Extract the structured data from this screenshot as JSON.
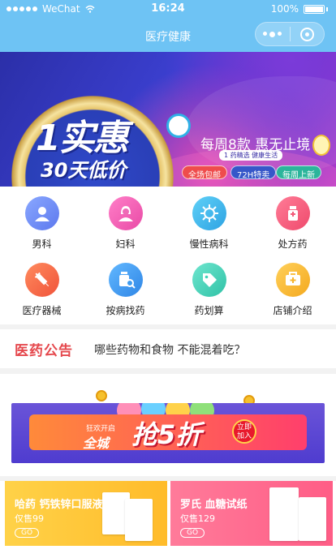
{
  "status_bar": {
    "signal": "●●●●●",
    "carrier": "WeChat",
    "time": "16:24",
    "battery": "100%"
  },
  "title_bar": {
    "title": "医疗健康"
  },
  "banner": {
    "headline": "1实惠",
    "sub_headline": "30天低价",
    "promo_text": "每周8款 惠无止境",
    "promo_sub": "1 药精选 健康生活",
    "tags": [
      "全场包邮",
      "72H特卖",
      "每周上新"
    ]
  },
  "categories": [
    {
      "label": "男科",
      "icon": "male-user-icon",
      "color": "#6d8df6"
    },
    {
      "label": "妇科",
      "icon": "female-user-icon",
      "color": "#f05fb4"
    },
    {
      "label": "慢性病科",
      "icon": "virus-icon",
      "color": "#3bb6ea"
    },
    {
      "label": "处方药",
      "icon": "medicine-bottle-icon",
      "color": "#f35b7a"
    },
    {
      "label": "医疗器械",
      "icon": "syringe-icon",
      "color": "#f56a4a"
    },
    {
      "label": "按病找药",
      "icon": "medicine-search-icon",
      "color": "#3f9cf0"
    },
    {
      "label": "药划算",
      "icon": "price-tag-icon",
      "color": "#3fd1b6"
    },
    {
      "label": "店铺介绍",
      "icon": "shop-icon",
      "color": "#f7b52e"
    }
  ],
  "notice": {
    "badge": "医药公告",
    "text": "哪些药物和食物 不能混着吃？"
  },
  "sale_banner": {
    "line1": "狂欢开启",
    "line2": "全城",
    "main": "抢5折",
    "button_line1": "立即",
    "button_line2": "加入"
  },
  "products": [
    {
      "name": "哈药 钙铁锌口服液",
      "price": "仅售99",
      "cta": "GO"
    },
    {
      "name": "罗氏 血糖试纸",
      "price": "仅售129",
      "cta": "GO"
    }
  ]
}
